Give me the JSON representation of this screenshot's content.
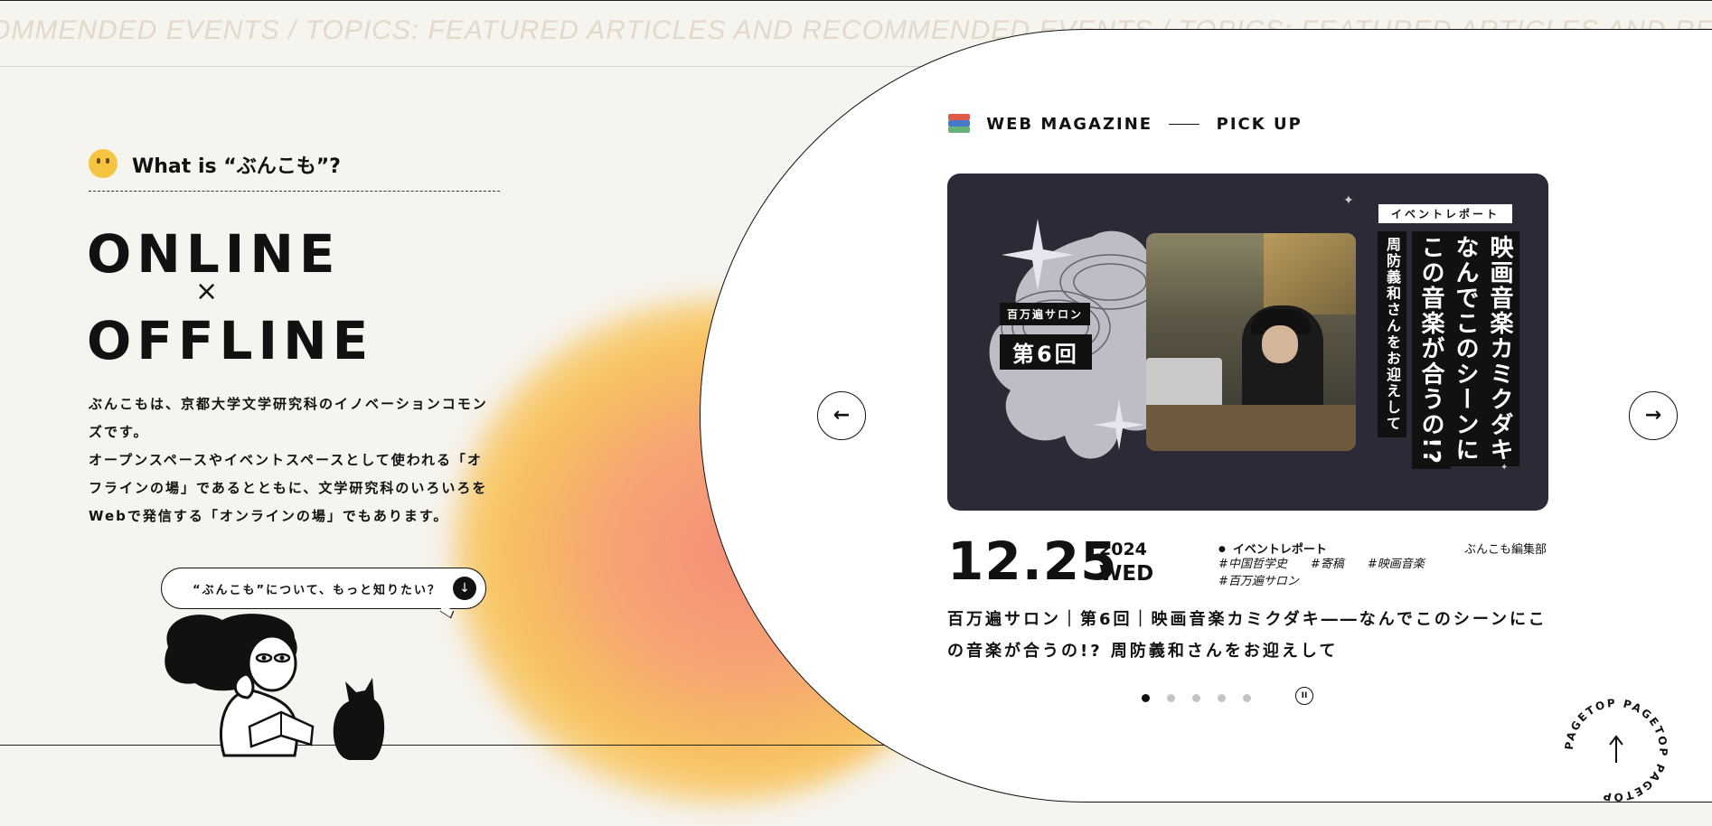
{
  "ticker": {
    "text": "OMMENDED EVENTS / TOPICS: FEATURED ARTICLES AND RECOMMENDED EVENTS / TOPICS: FEATURED ARTICLES AND RECOMM"
  },
  "about": {
    "heading": "What is “ぶんこも”?",
    "heading_icon": "thinking-face-emoji",
    "title_line1": "ONLINE",
    "title_cross": "×",
    "title_line2": "OFFLINE",
    "description_p1": "ぶんこもは、京都大学文学研究科のイノベーションコモンズです。",
    "description_p2": "オープンスペースやイベントスペースとして使われる「オフラインの場」であるとともに、文学研究科のいろいろをWebで発信する「オンラインの場」でもあります。",
    "more_button": "“ぶんこも”について、もっと知りたい？",
    "more_icon": "arrow-down-icon"
  },
  "pickup": {
    "section_label_left": "WEB MAGAZINE",
    "section_label_right": "PICK UP",
    "section_icon": "books-icon",
    "card": {
      "series_label": "百万遍サロン",
      "episode_label": "第6回",
      "category_badge": "イベントレポート",
      "title_col1": "映画音楽カミクダキ",
      "title_col2": "なんでこのシーンに",
      "title_col3": "この音楽が合うの!?",
      "subtitle_col": "周防義和さんをお迎えして"
    },
    "date": "12.25",
    "year": "2024",
    "weekday": "WED",
    "category": "イベントレポート",
    "author": "ぶんこも編集部",
    "tags": [
      "#中国哲学史",
      "#寄稿",
      "#映画音楽",
      "#百万遍サロン"
    ],
    "headline": "百万遍サロン｜第6回｜映画音楽カミクダキ――なんでこのシーンにこの音楽が合うの!? 周防義和さんをお迎えして",
    "prev_icon": "arrow-left-icon",
    "next_icon": "arrow-right-icon",
    "slide_count": 5,
    "active_slide": 1,
    "pause_icon": "pause-icon"
  },
  "pagetop": {
    "label": "PAGETOP PAGETOP PAGETOP",
    "icon": "arrow-up-icon"
  },
  "colors": {
    "background": "#f6f4ef",
    "card": "#2b2a36",
    "ink": "#111111",
    "ticker": "#e2d9c9"
  }
}
